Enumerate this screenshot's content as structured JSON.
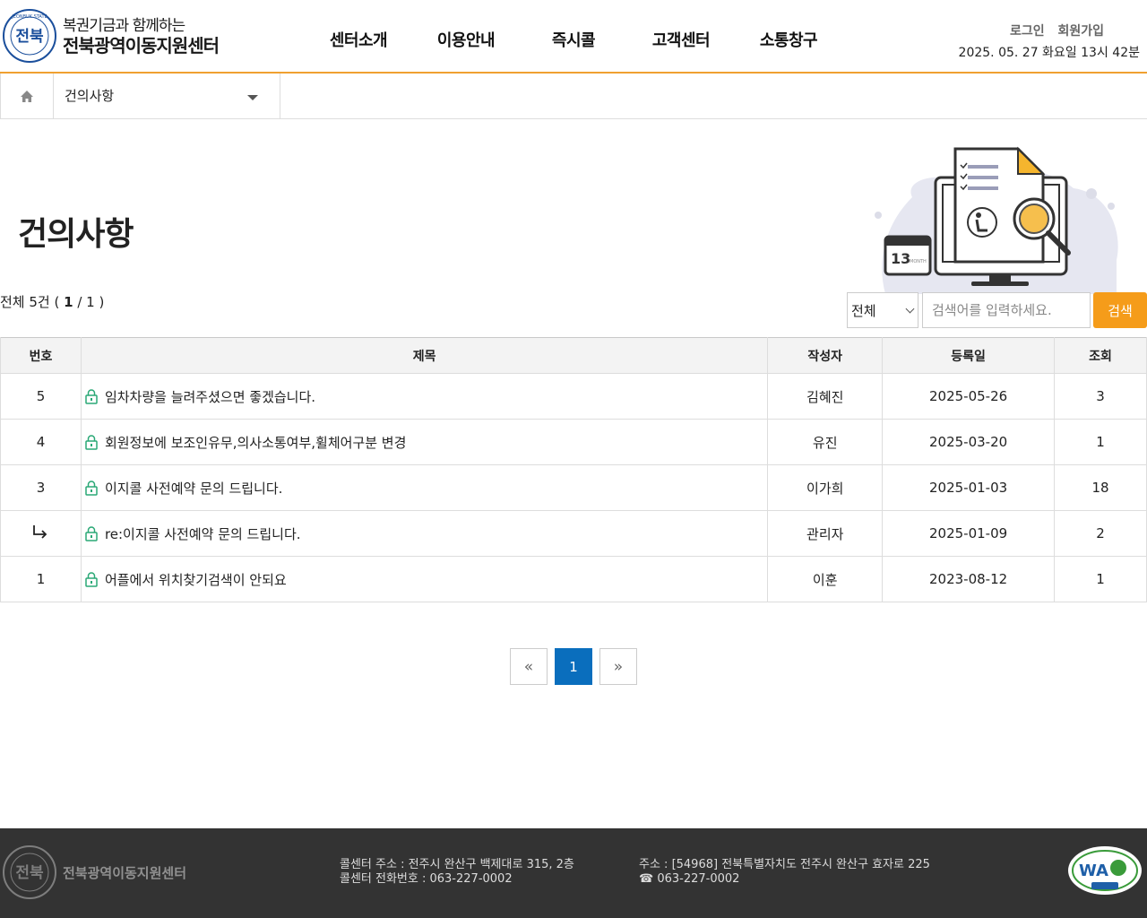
{
  "header": {
    "logo_sub": "복권기금과 함께하는",
    "logo_main": "전북광역이동지원센터",
    "nav": [
      "센터소개",
      "이용안내",
      "즉시콜",
      "고객센터",
      "소통창구"
    ],
    "login": "로그인",
    "signup": "회원가입",
    "datetime": "2025. 05. 27 화요일 13시 42분"
  },
  "location": {
    "current": "건의사항"
  },
  "page": {
    "title": "건의사항",
    "count_prefix": "전체 5건 ( ",
    "page_current": "1",
    "page_sep": " / 1 )"
  },
  "search": {
    "scope": "전체",
    "placeholder": "검색어를 입력하세요.",
    "button": "검색"
  },
  "table": {
    "headers": [
      "번호",
      "제목",
      "작성자",
      "등록일",
      "조회"
    ],
    "rows": [
      {
        "no": "5",
        "title": "임차차량을 늘려주셨으면 좋겠습니다.",
        "author": "김혜진",
        "date": "2025-05-26",
        "views": "3"
      },
      {
        "no": "4",
        "title": "회원정보에 보조인유무,의사소통여부,휠체어구분 변경",
        "author": "유진",
        "date": "2025-03-20",
        "views": "1"
      },
      {
        "no": "3",
        "title": "이지콜 사전예약 문의 드립니다.",
        "author": "이가희",
        "date": "2025-01-03",
        "views": "18"
      },
      {
        "no": "",
        "title": "re:이지콜 사전예약 문의 드립니다.",
        "author": "관리자",
        "date": "2025-01-09",
        "views": "2"
      },
      {
        "no": "1",
        "title": "어플에서 위치찾기검색이 안되요",
        "author": "이훈",
        "date": "2023-08-12",
        "views": "1"
      }
    ]
  },
  "pagination": {
    "first": "«",
    "current": "1",
    "last": "»"
  },
  "footer": {
    "name": "전북광역이동지원센터",
    "callcenter_address": "콜센터 주소 : 전주시 완산구 백제대로 315, 2층",
    "callcenter_phone": "콜센터 전화번호 : 063-227-0002",
    "address": "주소 : [54968] 전북특별자치도 전주시 완산구 효자로 225",
    "phone": "☎ 063-227-0002"
  },
  "icons": {
    "home": "home-icon",
    "lock": "lock-icon",
    "reply": "reply-arrow-icon"
  },
  "colors": {
    "accent": "#f59c1a",
    "header_line": "#f0a030",
    "pager_active": "#0a6ebd",
    "footer_bg": "#333333"
  }
}
